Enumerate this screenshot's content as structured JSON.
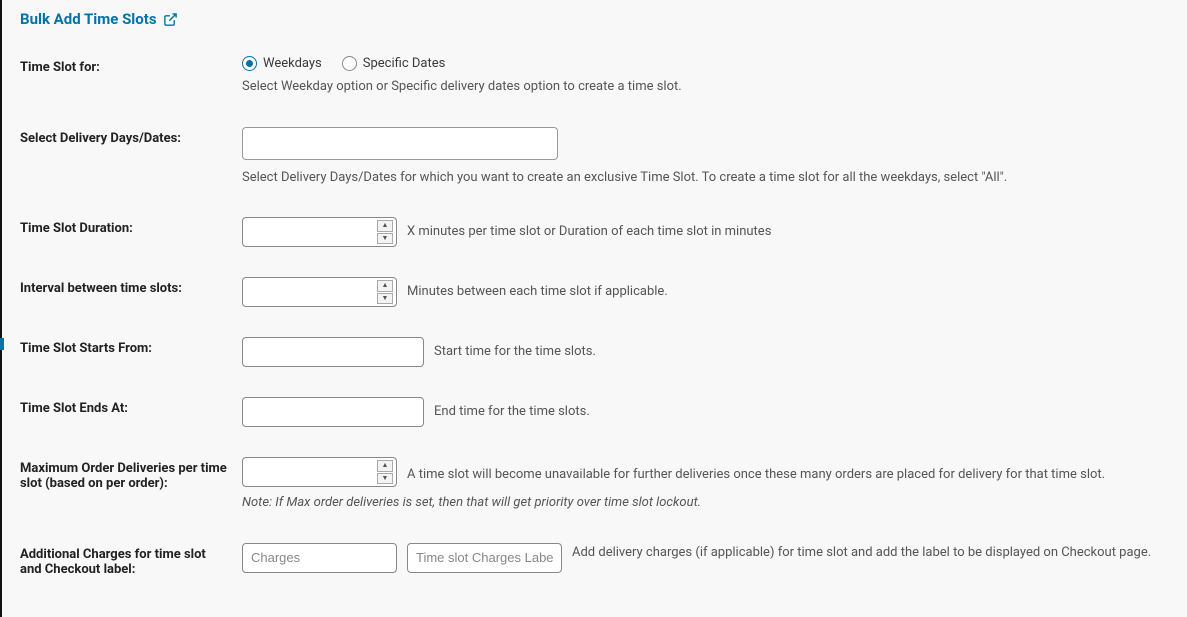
{
  "heading": "Bulk Add Time Slots",
  "rows": {
    "time_slot_for": {
      "label": "Time Slot for:",
      "option_weekdays": "Weekdays",
      "option_specific": "Specific Dates",
      "helper": "Select Weekday option or Specific delivery dates option to create a time slot."
    },
    "select_days": {
      "label": "Select Delivery Days/Dates:",
      "helper": "Select Delivery Days/Dates for which you want to create an exclusive Time Slot. To create a time slot for all the weekdays, select \"All\"."
    },
    "duration": {
      "label": "Time Slot Duration:",
      "helper": "X minutes per time slot or Duration of each time slot in minutes"
    },
    "interval": {
      "label": "Interval between time slots:",
      "helper": "Minutes between each time slot if applicable."
    },
    "starts": {
      "label": "Time Slot Starts From:",
      "helper": "Start time for the time slots."
    },
    "ends": {
      "label": "Time Slot Ends At:",
      "helper": "End time for the time slots."
    },
    "max_deliveries": {
      "label": "Maximum Order Deliveries per time slot (based on per order):",
      "helper": "A time slot will become unavailable for further deliveries once these many orders are placed for delivery for that time slot.",
      "note": "Note: If Max order deliveries is set, then that will get priority over time slot lockout."
    },
    "charges": {
      "label": "Additional Charges for time slot and Checkout label:",
      "placeholder_charges": "Charges",
      "placeholder_label": "Time slot Charges Label",
      "helper": "Add delivery charges (if applicable) for time slot and add the label to be displayed on Checkout page."
    }
  }
}
